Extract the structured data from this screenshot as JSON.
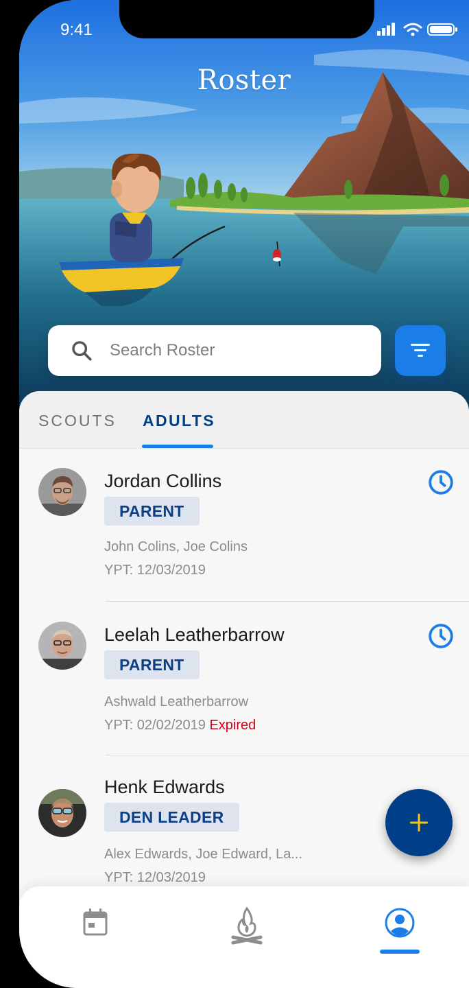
{
  "status_bar": {
    "time": "9:41"
  },
  "header": {
    "title": "Roster"
  },
  "search": {
    "placeholder": "Search Roster"
  },
  "tabs": [
    {
      "label": "SCOUTS",
      "active": false
    },
    {
      "label": "ADULTS",
      "active": true
    }
  ],
  "members": [
    {
      "name": "Jordan Collins",
      "role": "PARENT",
      "relations": "John Colins, Joe Colins",
      "ypt": "YPT: 12/03/2019",
      "ypt_status": ""
    },
    {
      "name": "Leelah Leatherbarrow",
      "role": "PARENT",
      "relations": "Ashwald Leatherbarrow",
      "ypt": "YPT: 02/02/2019",
      "ypt_status": "Expired"
    },
    {
      "name": "Henk Edwards",
      "role": "DEN LEADER",
      "relations": "Alex Edwards, Joe Edward, La...",
      "ypt": "YPT: 12/03/2019",
      "ypt_status": ""
    }
  ],
  "bottom_nav": [
    {
      "icon": "calendar-icon",
      "active": false
    },
    {
      "icon": "campfire-icon",
      "active": false
    },
    {
      "icon": "profile-icon",
      "active": true
    }
  ],
  "colors": {
    "primary": "#1a7de8",
    "navy": "#003f87",
    "badge_bg": "#dde4ee",
    "expired": "#d0021b",
    "fab_plus": "#f5c518"
  }
}
